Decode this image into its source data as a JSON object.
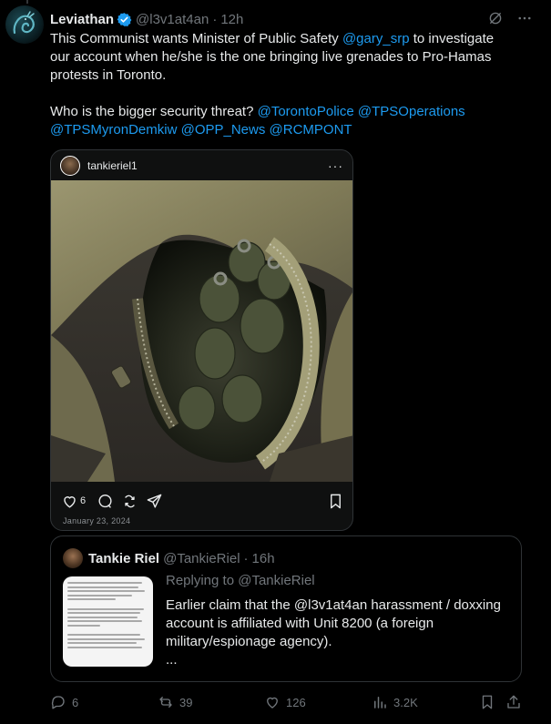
{
  "tweet": {
    "author_name": "Leviathan",
    "author_handle": "@l3v1at4an",
    "separator": "·",
    "time": "12h",
    "text_lines": [
      {
        "parts": [
          "This Communist wants Minister of Public Safety ",
          "@gary_srp",
          " to investigate"
        ]
      },
      {
        "parts": [
          "our account when he/she is the one bringing live grenades to Pro-Hamas"
        ]
      },
      {
        "parts": [
          "protests in Toronto."
        ]
      },
      {
        "parts": [
          "Who is the bigger security threat? ",
          "@TorontoPolice",
          " ",
          "@TPSOperations"
        ]
      },
      {
        "parts": [
          "@TPSMyronDemkiw",
          " ",
          "@OPP_News",
          " ",
          "@RCMPONT"
        ]
      }
    ],
    "header_icons": [
      "grok-icon",
      "more-icon"
    ]
  },
  "embed": {
    "username": "tankieriel1",
    "more": "···",
    "likes": "6",
    "date": "January 23, 2024",
    "icons": [
      "heart-icon",
      "comment-icon",
      "repost-icon",
      "share-icon",
      "bookmark-icon"
    ]
  },
  "quote": {
    "author_name": "Tankie Riel",
    "author_handle": "@TankieRiel",
    "separator": "·",
    "time": "16h",
    "replying_to": "Replying to @TankieRiel",
    "text_lines": [
      "Earlier claim that the @l3v1at4an harassment / doxxing",
      "account is affiliated with Unit 8200 (a foreign",
      "military/espionage agency).",
      "..."
    ]
  },
  "actions": {
    "replies": "6",
    "reposts": "39",
    "likes": "126",
    "views": "3.2K"
  },
  "colors": {
    "accent": "#1d9bf0",
    "muted": "#71767b",
    "text": "#e7e9ea",
    "border": "#2f3336"
  }
}
